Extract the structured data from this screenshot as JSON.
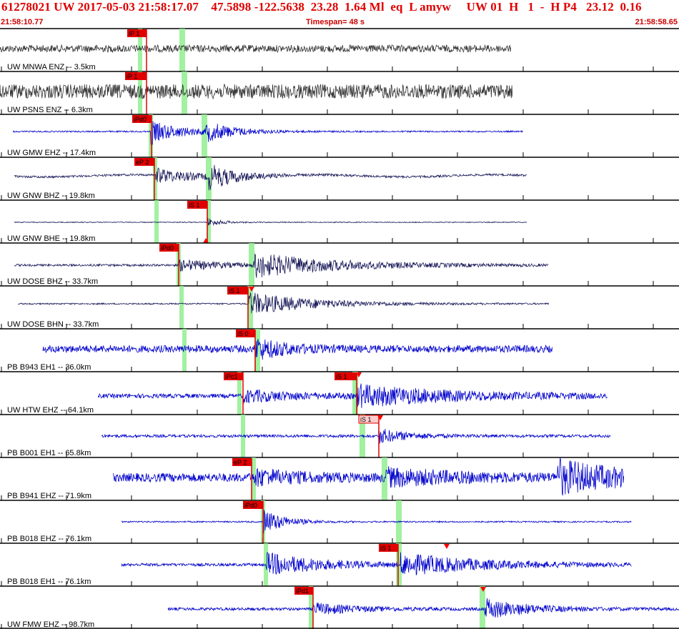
{
  "header": {
    "title": "61278021 UW 2017-05-03 21:58:17.07    47.5898 -122.5638  23.28  1.64 Ml  eq  L amyw     UW 01  H   1  -  H P4   23.12  0.16",
    "start_time": "21:58:10.77",
    "timespan": "Timespan=  48 s",
    "end_time": "21:58:58.65"
  },
  "colors": {
    "panel_sep": "#000000",
    "trace_dark": "#333333",
    "trace_blue": "#0000cc",
    "trace_navy": "#1a1a5a",
    "pick_red": "#e00000",
    "pick_pink": "#ffcccc",
    "window_green": "#90ee90",
    "triangle_red": "#ff0000"
  },
  "channels": [
    {
      "label": "UW MNWA ENZ -- 3.5km",
      "color": "dark",
      "picks": [
        {
          "text": "iP 1"
        }
      ]
    },
    {
      "label": "UW PSNS ENZ -- 6.3km",
      "color": "dark",
      "picks": [
        {
          "text": "iP 1"
        }
      ]
    },
    {
      "label": "UW GMW EHZ -- 17.4km",
      "color": "blue",
      "picks": [
        {
          "text": "iPd0"
        }
      ]
    },
    {
      "label": "UW GNW BHZ -- 19.8km",
      "color": "navy",
      "picks": [
        {
          "text": "eP 2"
        }
      ]
    },
    {
      "label": "UW GNW BHE -- 19.8km",
      "color": "navy",
      "picks": [
        {
          "text": "iS 1"
        }
      ]
    },
    {
      "label": "UW DOSE BHZ -- 33.7km",
      "color": "navy",
      "picks": [
        {
          "text": "iPd0"
        }
      ]
    },
    {
      "label": "UW DOSE BHN -- 33.7km",
      "color": "navy",
      "picks": [
        {
          "text": "iS 1"
        }
      ]
    },
    {
      "label": "PB B943 EH1 -- 36.0km",
      "color": "blue",
      "picks": [
        {
          "text": "iS 0"
        }
      ]
    },
    {
      "label": "UW HTW EHZ -- 64.1km",
      "color": "blue",
      "picks": [
        {
          "text": "iPc1"
        },
        {
          "text": "iS 1"
        }
      ]
    },
    {
      "label": "PB B001 EH1 -- 65.8km",
      "color": "blue",
      "picks": [
        {
          "text": "iS 1"
        }
      ]
    },
    {
      "label": "PB B941 EHZ -- 71.9km",
      "color": "blue",
      "picks": [
        {
          "text": "eP 2"
        }
      ]
    },
    {
      "label": "PB B018 EHZ -- 76.1km",
      "color": "blue",
      "picks": [
        {
          "text": "iPd0"
        }
      ]
    },
    {
      "label": "PB B018 EH1 -- 76.1km",
      "color": "blue",
      "picks": [
        {
          "text": "iS 1"
        }
      ]
    },
    {
      "label": "UW FMW EHZ -- 98.7km",
      "color": "blue",
      "picks": [
        {
          "text": "iPd1"
        }
      ]
    }
  ]
}
